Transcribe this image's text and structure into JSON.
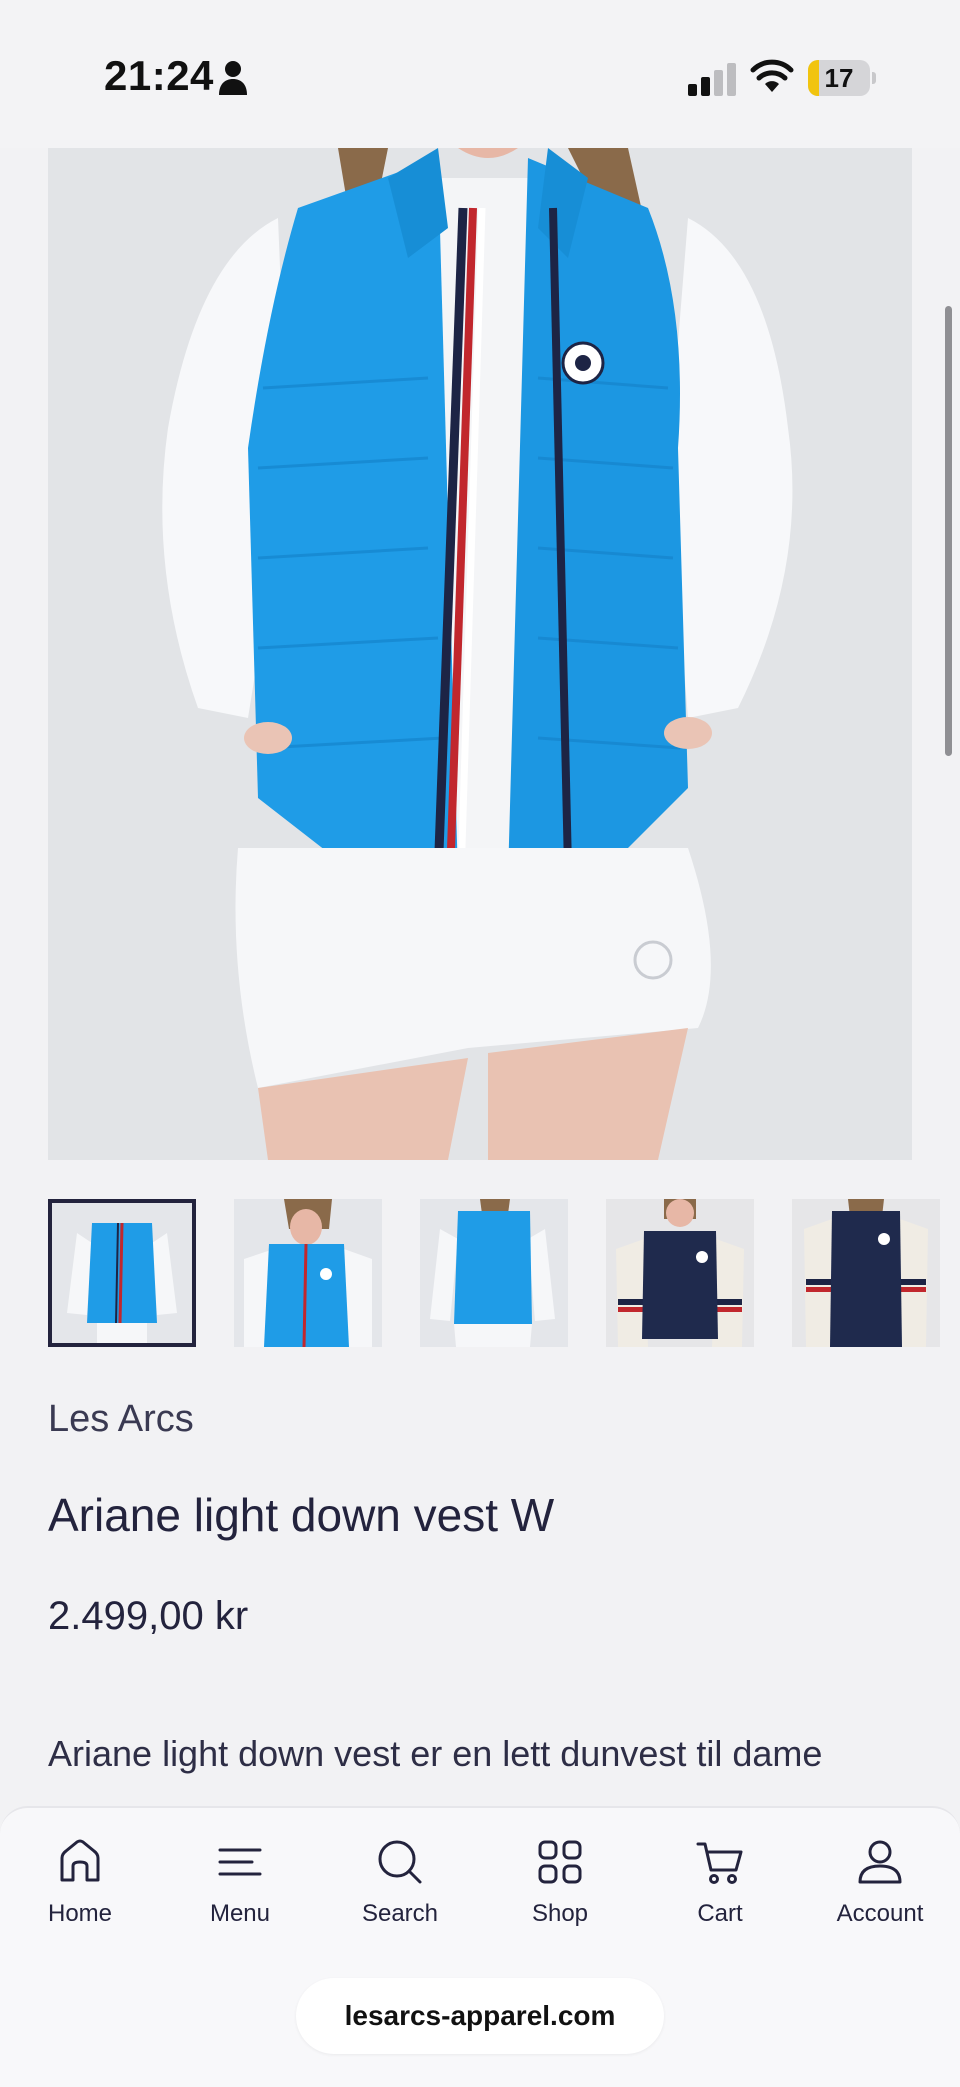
{
  "status_bar": {
    "time": "21:24",
    "battery_level": "17",
    "battery_fraction": 0.17
  },
  "colors": {
    "accent": "#23233d",
    "vest_blue": "#1e9be6",
    "navy": "#1f2a4d",
    "battery_yellow": "#f1c40f"
  },
  "product": {
    "brand": "Les Arcs",
    "title": "Ariane light down vest W",
    "price": "2.499,00 kr",
    "description": "Ariane light down vest er en lett dunvest til dame"
  },
  "gallery": {
    "hero_image": "woman-in-blue-down-vest",
    "thumbnails": [
      {
        "name": "thumb-blue-front",
        "active": true
      },
      {
        "name": "thumb-blue-side",
        "active": false
      },
      {
        "name": "thumb-blue-back",
        "active": false
      },
      {
        "name": "thumb-navy-front",
        "active": false
      },
      {
        "name": "thumb-navy-front-2",
        "active": false
      }
    ]
  },
  "bottom_nav": {
    "items": [
      {
        "label": "Home",
        "icon": "home-icon"
      },
      {
        "label": "Menu",
        "icon": "menu-icon"
      },
      {
        "label": "Search",
        "icon": "search-icon"
      },
      {
        "label": "Shop",
        "icon": "grid-icon"
      },
      {
        "label": "Cart",
        "icon": "cart-icon"
      },
      {
        "label": "Account",
        "icon": "account-icon"
      }
    ]
  },
  "browser": {
    "url": "lesarcs-apparel.com"
  }
}
